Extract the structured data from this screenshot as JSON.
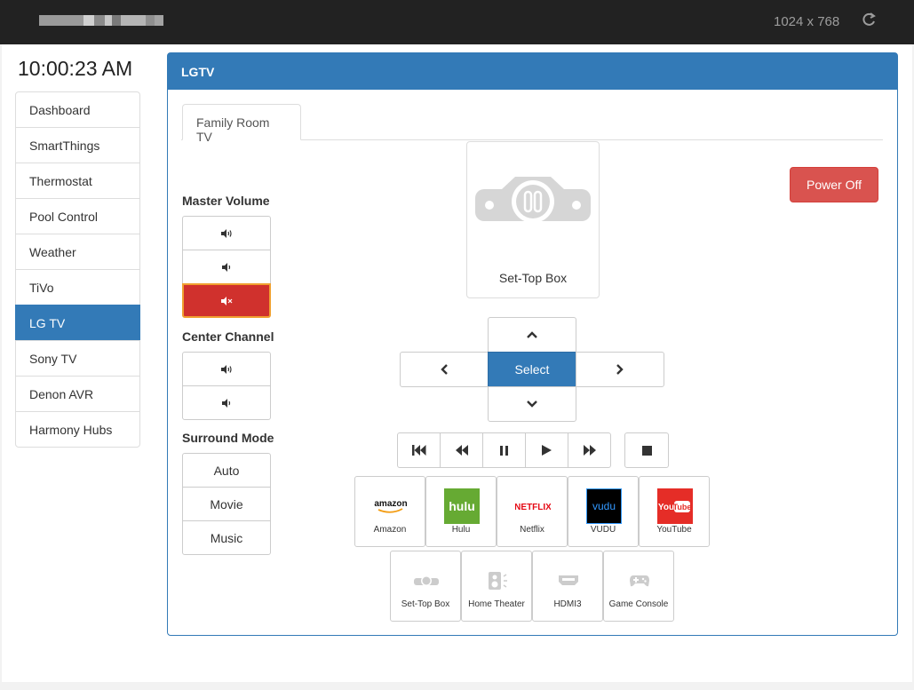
{
  "topbar": {
    "title_blur": [
      "#9a9a9a",
      "#bdbdbd",
      "#8a8a8a",
      "#c7c7c7",
      "#a3a3a3",
      "#d0d0d0",
      "#8f8f8f",
      "#b5b5b5"
    ],
    "resolution": "1024 x 768",
    "refresh_icon": "refresh-icon"
  },
  "clock": "10:00:23 AM",
  "sidebar": {
    "items": [
      {
        "label": "Dashboard",
        "active": false
      },
      {
        "label": "SmartThings",
        "active": false
      },
      {
        "label": "Thermostat",
        "active": false
      },
      {
        "label": "Pool Control",
        "active": false
      },
      {
        "label": "Weather",
        "active": false
      },
      {
        "label": "TiVo",
        "active": false
      },
      {
        "label": "LG TV",
        "active": true
      },
      {
        "label": "Sony TV",
        "active": false
      },
      {
        "label": "Denon AVR",
        "active": false
      },
      {
        "label": "Harmony Hubs",
        "active": false
      }
    ]
  },
  "panel": {
    "title": "LGTV",
    "tab": "Family Room TV",
    "master_volume": {
      "label": "Master Volume",
      "buttons": [
        "volume-up-icon",
        "volume-down-icon",
        "mute-icon"
      ]
    },
    "center_channel": {
      "label": "Center Channel",
      "buttons": [
        "volume-up-icon",
        "volume-down-icon"
      ]
    },
    "surround_mode": {
      "label": "Surround Mode",
      "options": [
        "Auto",
        "Movie",
        "Music"
      ]
    },
    "current_input": "Set-Top Box",
    "power_button": "Power Off",
    "dpad": {
      "select": "Select",
      "up_icon": "chevron-up-icon",
      "down_icon": "chevron-down-icon",
      "left_icon": "chevron-left-icon",
      "right_icon": "chevron-right-icon"
    },
    "transport": [
      "skip-back-icon",
      "rewind-icon",
      "pause-icon",
      "play-icon",
      "fast-forward-icon"
    ],
    "stop_icon": "stop-icon",
    "apps": [
      {
        "name": "Amazon",
        "logo_text": "amazon",
        "color": "#ffffff"
      },
      {
        "name": "Hulu",
        "logo_text": "hulu",
        "color": "#66aa33"
      },
      {
        "name": "Netflix",
        "logo_text": "NETFLIX",
        "color": "#e50914"
      },
      {
        "name": "VUDU",
        "logo_text": "vudu",
        "color": "#3399ff"
      },
      {
        "name": "YouTube",
        "logo_text": "You Tube",
        "color": "#e52d27"
      }
    ],
    "inputs": [
      {
        "name": "Set-Top Box",
        "icon": "set-top-box-icon"
      },
      {
        "name": "Home Theater",
        "icon": "speaker-icon"
      },
      {
        "name": "HDMI3",
        "icon": "hdmi-icon"
      },
      {
        "name": "Game Console",
        "icon": "gamepad-icon"
      }
    ]
  }
}
